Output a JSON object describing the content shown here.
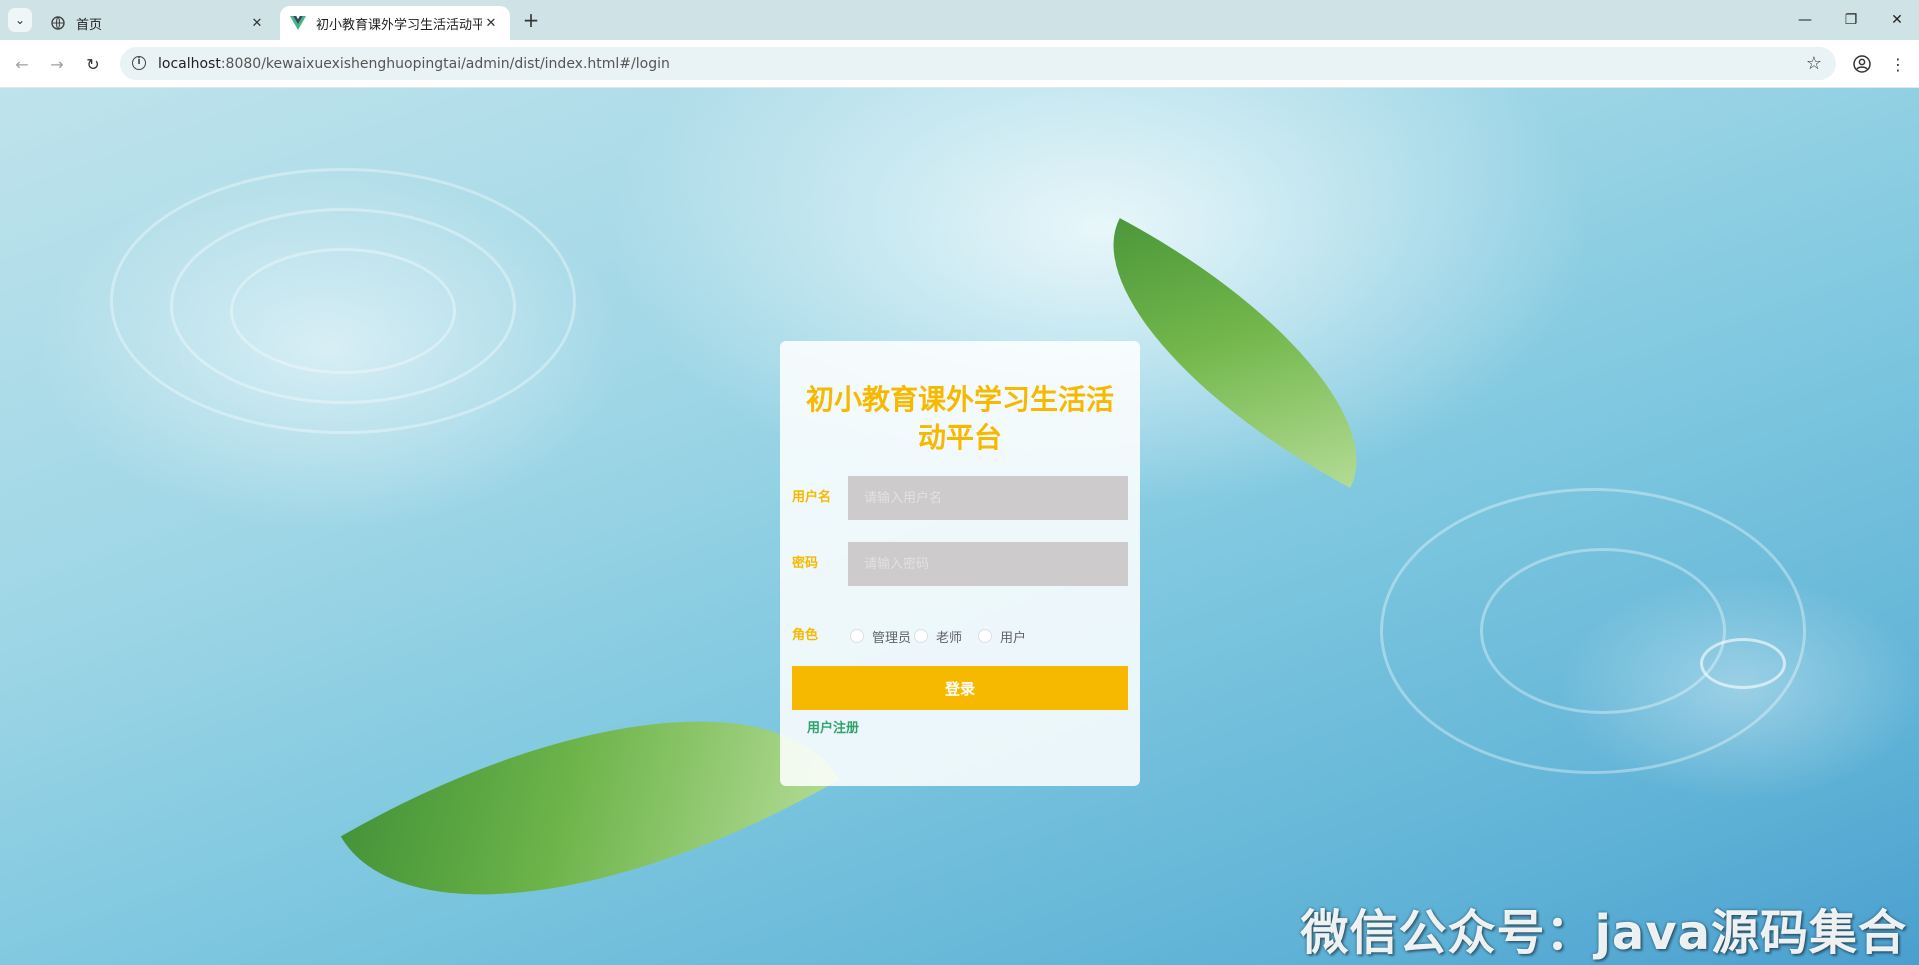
{
  "browser": {
    "tabs": [
      {
        "title": "首页",
        "icon": "globe-icon",
        "active": false
      },
      {
        "title": "初小教育课外学习生活活动平台",
        "icon": "vue-logo-icon",
        "active": true
      }
    ],
    "address": "localhost:8080/kewaixuexishenghuopingtai/admin/dist/index.html#/login",
    "address_host": "localhost",
    "address_rest": ":8080/kewaixuexishenghuopingtai/admin/dist/index.html#/login"
  },
  "login": {
    "title": "初小教育课外学习生活活动平台",
    "username_label": "用户名",
    "username_placeholder": "请输入用户名",
    "password_label": "密码",
    "password_placeholder": "请输入密码",
    "role_label": "角色",
    "roles": [
      "管理员",
      "老师",
      "用户"
    ],
    "login_button": "登录",
    "register_link": "用户注册"
  },
  "watermark": "微信公众号：java源码集合",
  "colors": {
    "accent": "#f7b900",
    "register": "#2fa36b",
    "input_bg": "#cdcbcb"
  }
}
